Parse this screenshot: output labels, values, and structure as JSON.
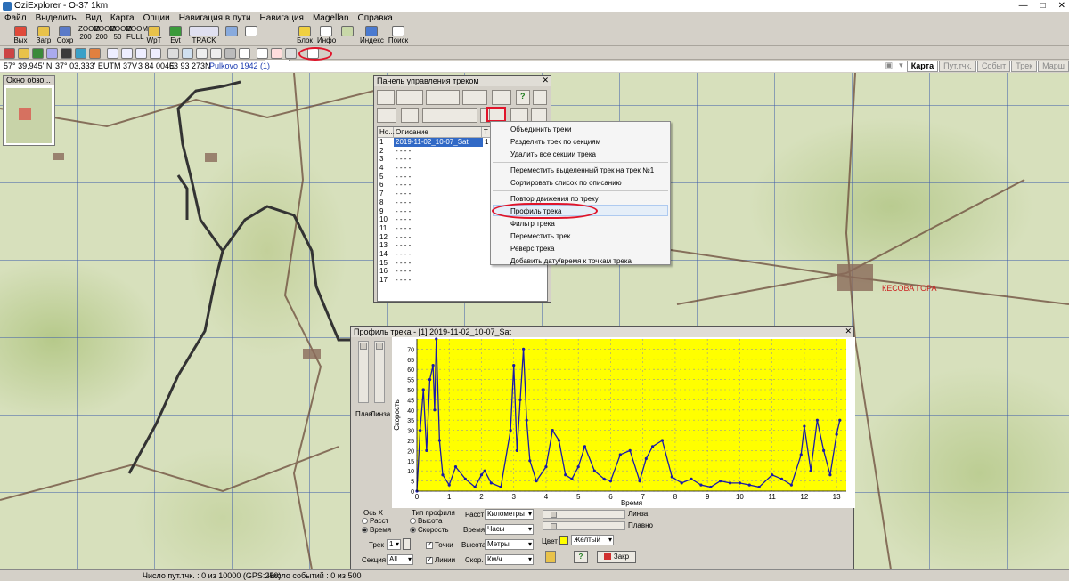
{
  "window": {
    "title": "OziExplorer - O-37 1km"
  },
  "menu": [
    "Файл",
    "Выделить",
    "Вид",
    "Карта",
    "Опции",
    "Навигация в пути",
    "Навигация",
    "Magellan",
    "Справка"
  ],
  "toolbar1": {
    "exit": "Вых",
    "load": "Загр",
    "save": "Сохр",
    "zoom": [
      "200",
      "200",
      "50",
      "FULL"
    ],
    "zoom_top": [
      "ZOOM",
      "ZOOM",
      "ZOOM",
      "ZOOM"
    ],
    "wpt": "WpT",
    "evt": "Evt",
    "track": "TRACK",
    "zoom_value": "50",
    "block": "Блок",
    "info": "Инфо",
    "index": "Индекс",
    "search": "Поиск"
  },
  "status": {
    "lat": "57° 39,945' N",
    "lon": "37° 03,333' E",
    "utm": "UTM  37V",
    "easting": "3 84 004E",
    "northing": "63 93 273N",
    "datum": "Pulkovo 1942 (1)"
  },
  "view_tabs": [
    "Карта",
    "Пут.тчк.",
    "Событ",
    "Трек",
    "Марш"
  ],
  "overview": {
    "title": "Окно обзо..."
  },
  "track_panel": {
    "title": "Панель управления треком",
    "columns": [
      "Но...",
      "Описание",
      "T"
    ],
    "rows": [
      {
        "n": "1",
        "d": "2019-11-02_10-07_Sat",
        "t": "1"
      },
      {
        "n": "2",
        "d": "- - - -",
        "t": ""
      },
      {
        "n": "3",
        "d": "- - - -",
        "t": ""
      },
      {
        "n": "4",
        "d": "- - - -",
        "t": ""
      },
      {
        "n": "5",
        "d": "- - - -",
        "t": ""
      },
      {
        "n": "6",
        "d": "- - - -",
        "t": ""
      },
      {
        "n": "7",
        "d": "- - - -",
        "t": ""
      },
      {
        "n": "8",
        "d": "- - - -",
        "t": ""
      },
      {
        "n": "9",
        "d": "- - - -",
        "t": ""
      },
      {
        "n": "10",
        "d": "- - - -",
        "t": ""
      },
      {
        "n": "11",
        "d": "- - - -",
        "t": ""
      },
      {
        "n": "12",
        "d": "- - - -",
        "t": ""
      },
      {
        "n": "13",
        "d": "- - - -",
        "t": ""
      },
      {
        "n": "14",
        "d": "- - - -",
        "t": ""
      },
      {
        "n": "15",
        "d": "- - - -",
        "t": ""
      },
      {
        "n": "16",
        "d": "- - - -",
        "t": ""
      },
      {
        "n": "17",
        "d": "- - - -",
        "t": ""
      }
    ]
  },
  "context_menu": {
    "items": [
      "Объединить треки",
      "Разделить трек по секциям",
      "Удалить все секции трека",
      "Переместить выделенный трек на трек №1",
      "Сортировать список по описанию",
      "Повтор движения по треку",
      "Профиль трека",
      "Фильтр трека",
      "Переместить трек",
      "Реверс трека",
      "Добавить дату/время к точкам трека"
    ],
    "highlighted": "Профиль трека"
  },
  "profile": {
    "title": "Профиль трека - [1] 2019-11-02_10-07_Sat",
    "slider1": "Плав",
    "slider2": "Линза",
    "axis_x": {
      "label": "Ось X",
      "opt1": "Расст",
      "opt2": "Время"
    },
    "profile_type": {
      "label": "Тип профиля",
      "opt1": "Высота",
      "opt2": "Скорость"
    },
    "dist_label": "Расст",
    "dist_value": "Километры",
    "time_label": "Время",
    "time_value": "Часы",
    "height_label": "Высота",
    "height_value": "Метры",
    "speed_label": "Скор.",
    "speed_value": "Км/ч",
    "lens": "Линза",
    "smooth": "Плавно",
    "color_label": "Цвет",
    "color_value": "Желтый",
    "track_label": "Трек",
    "track_value": "1",
    "section_label": "Секция",
    "section_value": "All",
    "points": "Точки",
    "lines": "Линии",
    "help": "?",
    "close": "Закр"
  },
  "bottom": {
    "left": "Число пут.тчк. : 0 из 10000  (GPS:250)",
    "right": "Число событий : 0 из 500"
  },
  "chart_data": {
    "type": "line",
    "xlabel": "Время",
    "ylabel": "Скорость",
    "xlim": [
      0,
      13.3
    ],
    "ylim": [
      0,
      75
    ],
    "xticks": [
      0,
      1,
      2,
      3,
      4,
      5,
      6,
      7,
      8,
      9,
      10,
      11,
      12,
      13
    ],
    "yticks": [
      0,
      5,
      10,
      15,
      20,
      25,
      30,
      35,
      40,
      45,
      50,
      55,
      60,
      65,
      70
    ],
    "background": "#ffff00",
    "line_color": "#1a1aa8",
    "series": [
      {
        "x": [
          0,
          0.1,
          0.2,
          0.3,
          0.4,
          0.5,
          0.55,
          0.6,
          0.7,
          0.8,
          1,
          1.2,
          1.5,
          1.8,
          2,
          2.1,
          2.3,
          2.6,
          2.9,
          3,
          3.1,
          3.2,
          3.3,
          3.4,
          3.5,
          3.7,
          4,
          4.2,
          4.4,
          4.6,
          4.8,
          5,
          5.2,
          5.5,
          5.8,
          6,
          6.3,
          6.6,
          6.9,
          7.1,
          7.3,
          7.6,
          7.9,
          8.2,
          8.5,
          8.8,
          9.1,
          9.4,
          9.7,
          10,
          10.3,
          10.6,
          11,
          11.3,
          11.6,
          11.9,
          12,
          12.2,
          12.4,
          12.6,
          12.8,
          13,
          13.1
        ],
        "y": [
          0,
          30,
          50,
          20,
          55,
          62,
          40,
          75,
          25,
          8,
          3,
          12,
          6,
          2,
          8,
          10,
          4,
          2,
          30,
          62,
          20,
          45,
          70,
          35,
          15,
          5,
          12,
          30,
          25,
          8,
          6,
          12,
          22,
          10,
          6,
          5,
          18,
          20,
          5,
          16,
          22,
          25,
          7,
          4,
          6,
          3,
          2,
          5,
          4,
          4,
          3,
          2,
          8,
          6,
          3,
          18,
          32,
          10,
          35,
          20,
          8,
          28,
          35
        ]
      }
    ]
  }
}
